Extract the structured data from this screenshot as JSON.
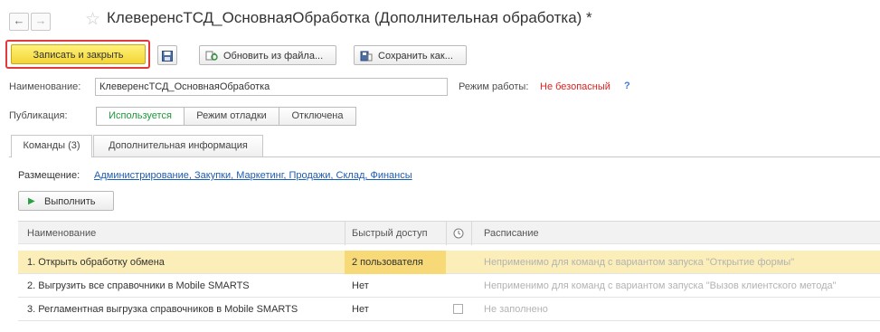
{
  "window": {
    "title": "КлеверенсТСД_ОсновнаяОбработка (Дополнительная обработка) *"
  },
  "toolbar": {
    "save_close_label": "Записать и закрыть",
    "update_from_file_label": "Обновить из файла...",
    "save_as_label": "Сохранить как..."
  },
  "form": {
    "name_label": "Наименование:",
    "name_value": "КлеверенсТСД_ОсновнаяОбработка",
    "mode_label": "Режим работы:",
    "mode_value": "Не безопасный",
    "mode_help": "?",
    "publication_label": "Публикация:",
    "publication_options": [
      "Используется",
      "Режим отладки",
      "Отключена"
    ],
    "publication_selected": "Используется"
  },
  "tabs": [
    "Команды (3)",
    "Дополнительная информация"
  ],
  "commands": {
    "placement_label": "Размещение:",
    "placement_value": "Администрирование, Закупки, Маркетинг, Продажи, Склад, Финансы",
    "run_label": "Выполнить",
    "columns": [
      "Наименование",
      "Быстрый доступ",
      "Расписание"
    ],
    "rows": [
      {
        "name": "1. Открыть обработку обмена",
        "quick": "2 пользователя",
        "schedule": "Неприменимо для команд с вариантом запуска \"Открытие формы\"",
        "has_checkbox": false
      },
      {
        "name": "2. Выгрузить все справочники в Mobile SMARTS",
        "quick": "Нет",
        "schedule": "Неприменимо для команд с вариантом запуска \"Вызов клиентского метода\"",
        "has_checkbox": false
      },
      {
        "name": "3. Регламентная выгрузка справочников в Mobile SMARTS",
        "quick": "Нет",
        "schedule": "Не заполнено",
        "has_checkbox": true
      }
    ]
  },
  "colors": {
    "primary_button": "#f3d534",
    "highlight": "#e23a3a",
    "active_option": "#1a9a3a",
    "selected_row": "#fbeeb8",
    "link": "#1c5cb3"
  }
}
